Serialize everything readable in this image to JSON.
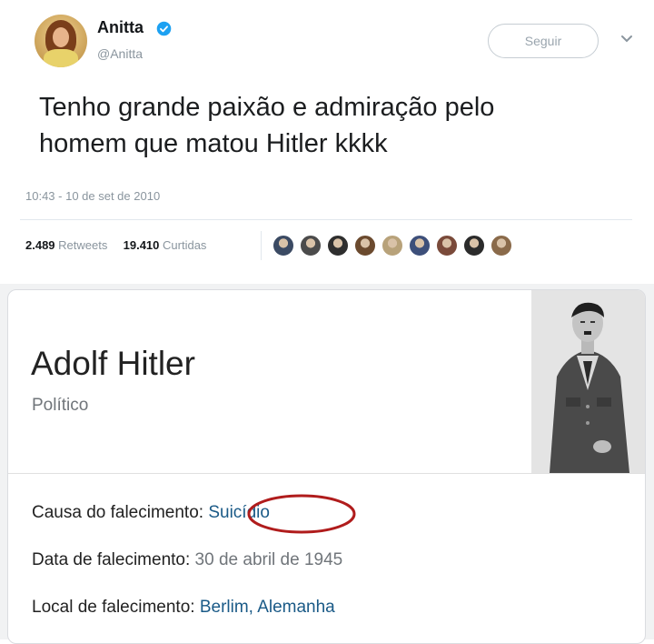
{
  "tweet": {
    "display_name": "Anitta",
    "handle": "@Anitta",
    "follow_label": "Seguir",
    "text_line_1": "Tenho grande paixão e admiração pelo",
    "text_line_2": "homem que matou Hitler kkkk",
    "timestamp": "10:43 - 10 de set de 2010",
    "retweets_count": "2.489",
    "retweets_label": "Retweets",
    "likes_count": "19.410",
    "likes_label": "Curtidas",
    "liker_avatar_colors": [
      "#3b4a63",
      "#4b4b4b",
      "#2e2e2e",
      "#6b4a2e",
      "#b8a27a",
      "#3d4f7a",
      "#7a4a3a",
      "#2b2b2b",
      "#8a6a4a"
    ],
    "verified_color": "#1da1f2"
  },
  "knowledge_panel": {
    "name": "Adolf Hitler",
    "subtitle": "Político",
    "facts": [
      {
        "label": "Causa do falecimento:",
        "value": "Suicídio"
      },
      {
        "label": "Data de falecimento:",
        "value": "30 de abril de 1945"
      },
      {
        "label": "Local de falecimento:",
        "value": "Berlim, Alemanha"
      }
    ],
    "annotation_color": "#b01c1c"
  }
}
